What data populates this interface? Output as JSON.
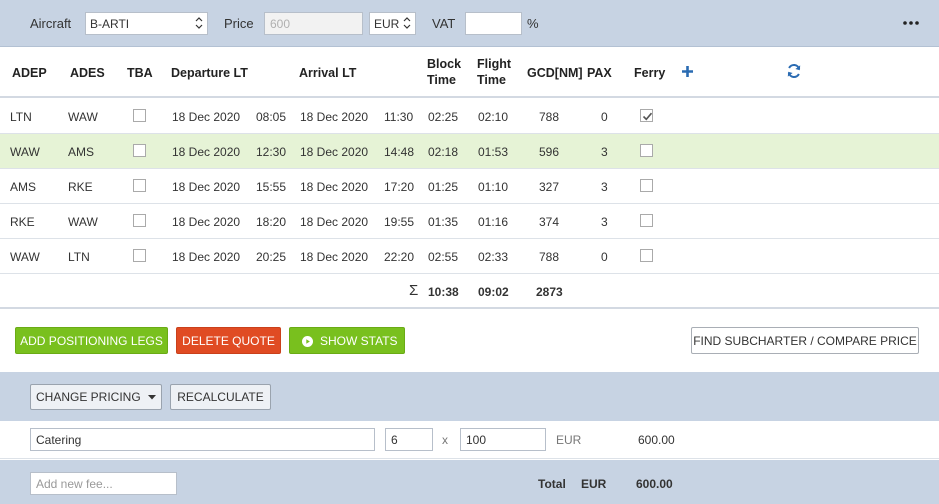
{
  "toolbar": {
    "aircraft_label": "Aircraft",
    "aircraft_value": "B-ARTI",
    "price_label": "Price",
    "price_placeholder": "600",
    "currency": "EUR",
    "vat_label": "VAT",
    "vat_value": "",
    "vat_unit": "%"
  },
  "table": {
    "headers": {
      "adep": "ADEP",
      "ades": "ADES",
      "tba": "TBA",
      "departure": "Departure LT",
      "arrival": "Arrival LT",
      "block_1": "Block",
      "block_2": "Time",
      "flight_1": "Flight",
      "flight_2": "Time",
      "gcd": "GCD[NM]",
      "pax": "PAX",
      "ferry": "Ferry"
    },
    "rows": [
      {
        "adep": "LTN",
        "ades": "WAW",
        "tba": false,
        "dep_date": "18 Dec 2020",
        "dep_time": "08:05",
        "arr_date": "18 Dec 2020",
        "arr_time": "11:30",
        "block": "02:25",
        "flight": "02:10",
        "gcd": "788",
        "pax": "0",
        "ferry": true
      },
      {
        "adep": "WAW",
        "ades": "AMS",
        "tba": false,
        "dep_date": "18 Dec 2020",
        "dep_time": "12:30",
        "arr_date": "18 Dec 2020",
        "arr_time": "14:48",
        "block": "02:18",
        "flight": "01:53",
        "gcd": "596",
        "pax": "3",
        "ferry": false
      },
      {
        "adep": "AMS",
        "ades": "RKE",
        "tba": false,
        "dep_date": "18 Dec 2020",
        "dep_time": "15:55",
        "arr_date": "18 Dec 2020",
        "arr_time": "17:20",
        "block": "01:25",
        "flight": "01:10",
        "gcd": "327",
        "pax": "3",
        "ferry": false
      },
      {
        "adep": "RKE",
        "ades": "WAW",
        "tba": false,
        "dep_date": "18 Dec 2020",
        "dep_time": "18:20",
        "arr_date": "18 Dec 2020",
        "arr_time": "19:55",
        "block": "01:35",
        "flight": "01:16",
        "gcd": "374",
        "pax": "3",
        "ferry": false
      },
      {
        "adep": "WAW",
        "ades": "LTN",
        "tba": false,
        "dep_date": "18 Dec 2020",
        "dep_time": "20:25",
        "arr_date": "18 Dec 2020",
        "arr_time": "22:20",
        "block": "02:55",
        "flight": "02:33",
        "gcd": "788",
        "pax": "0",
        "ferry": false
      }
    ],
    "totals": {
      "sigma": "Σ",
      "block": "10:38",
      "flight": "09:02",
      "gcd": "2873"
    }
  },
  "actions": {
    "add_positioning": "ADD POSITIONING LEGS",
    "delete_quote": "DELETE QUOTE",
    "show_stats": "SHOW STATS",
    "find_subcharter": "FIND SUBCHARTER / COMPARE PRICE"
  },
  "pricing": {
    "change_pricing": "CHANGE PRICING",
    "recalculate": "RECALCULATE"
  },
  "fee": {
    "name": "Catering",
    "quantity": "6",
    "times": "x",
    "unit_price": "100",
    "currency": "EUR",
    "amount": "600.00"
  },
  "footer": {
    "new_fee_placeholder": "Add new fee...",
    "total_label": "Total",
    "currency": "EUR",
    "total_value": "600.00"
  },
  "colors": {
    "toolbar_bg": "#c7d3e3",
    "highlight_row": "#e6f3d6",
    "accent_blue": "#2a6bb2",
    "green_button": "#79c01e",
    "red_button": "#e04b23"
  }
}
